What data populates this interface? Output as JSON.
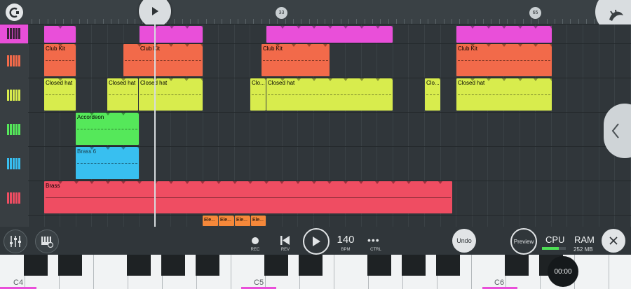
{
  "ruler": {
    "markers": [
      "33",
      "65"
    ]
  },
  "tracks": {
    "clips": [
      {
        "row": 0,
        "label": "",
        "color": "#e94fd9"
      },
      {
        "row": 1,
        "label": "Club Kit",
        "color": "#f26a4a"
      },
      {
        "row": 2,
        "label": "Closed hat",
        "color": "#d8ec4d"
      },
      {
        "row": 3,
        "label": "Accordeon",
        "color": "#55e85a"
      },
      {
        "row": 4,
        "label": "Brass 6",
        "color": "#38bff0"
      },
      {
        "row": 5,
        "label": "Brass",
        "color": "#ef4d62"
      }
    ],
    "clip_labels": {
      "club_kit": "Club Kit",
      "closed_hat": "Closed hat",
      "clo": "Clo...",
      "accordeon": "Accordeon",
      "brass6": "Brass 6",
      "brass": "Brass",
      "ele": "Ele..."
    }
  },
  "transport": {
    "rec_label": "REC",
    "rev_label": "REV",
    "bpm_value": "140",
    "bpm_label": "BPM",
    "ctrl_label": "CTRL",
    "undo_label": "Undo",
    "preview_label": "Preview",
    "cpu_label": "CPU",
    "ram_label": "RAM",
    "ram_value": "252 MB",
    "cpu_level": 0.7
  },
  "piano": {
    "octave_labels": [
      "C4",
      "C5",
      "C6"
    ]
  },
  "timer": {
    "value": "00:00"
  },
  "colors": {
    "pink": "#e94fd9",
    "orange": "#f26a4a",
    "yellow": "#d8ec4d",
    "green": "#55e85a",
    "blue": "#38bff0",
    "red": "#ef4d62",
    "small_orange": "#f5883a"
  }
}
